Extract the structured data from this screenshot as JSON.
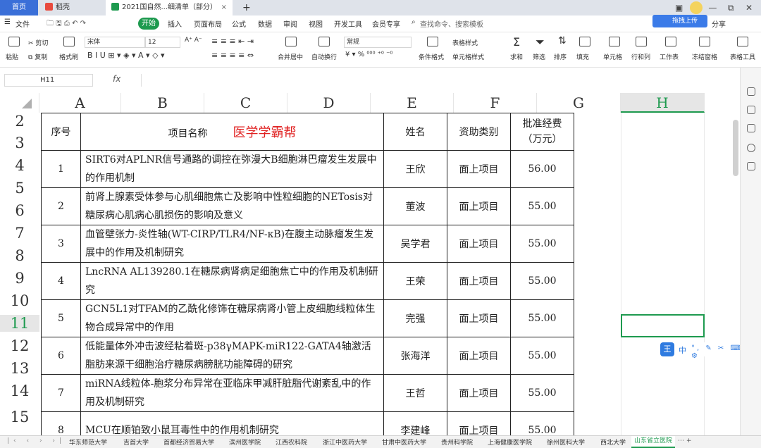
{
  "titlebar": {
    "tabs": [
      {
        "label": "首页"
      },
      {
        "label": "稻壳"
      },
      {
        "label": "2021国自然...细清单（部分）"
      }
    ],
    "add_tab": "+",
    "win_controls": {
      "min": "—",
      "restore": "⧉",
      "close": "✕"
    }
  },
  "menu": {
    "file": "文件",
    "start": "开始",
    "items": [
      "插入",
      "页面布局",
      "公式",
      "数据",
      "审阅",
      "视图",
      "开发工具",
      "会员专享"
    ],
    "search_placeholder": "查找命令、搜索模板",
    "share": "分享"
  },
  "ribbon": {
    "paste": "粘贴",
    "cut": "剪切",
    "copy": "复制",
    "format_painter": "格式刷",
    "font_name": "宋体",
    "font_size": "12",
    "merge": "合并居中",
    "wrap": "自动换行",
    "number_format": "常规",
    "conditional": "条件格式",
    "table_style": "表格样式",
    "cell_style": "单元格样式",
    "sum": "求和",
    "filter": "筛选",
    "sort": "排序",
    "fill": "填充",
    "cell": "单元格",
    "rowcol": "行和列",
    "worksheet": "工作表",
    "freeze": "冻结窗格",
    "table_tools": "表格工具",
    "upload": "拖拽上传"
  },
  "formula_bar": {
    "name_box": "H11",
    "fx": "fx",
    "value": ""
  },
  "columns": [
    "A",
    "B",
    "C",
    "D",
    "E",
    "F",
    "G",
    "H"
  ],
  "rows": [
    "2",
    "3",
    "4",
    "5",
    "6",
    "7",
    "8",
    "9",
    "10",
    "11",
    "12",
    "13",
    "14",
    "15"
  ],
  "table": {
    "headers": {
      "no": "序号",
      "name": "项目名称",
      "watermark": "医学学霸帮",
      "person": "姓名",
      "type": "资助类别",
      "fund": "批准经费（万元）"
    },
    "rows": [
      {
        "no": "1",
        "name": "SIRT6对APLNR信号通路的调控在弥漫大B细胞淋巴瘤发生发展中的作用机制",
        "person": "王欣",
        "type": "面上项目",
        "fund": "56.00"
      },
      {
        "no": "2",
        "name": "前肾上腺素受体参与心肌细胞焦亡及影响中性粒细胞的NETosis对糖尿病心肌病心肌损伤的影响及意义",
        "person": "董波",
        "type": "面上项目",
        "fund": "55.00"
      },
      {
        "no": "3",
        "name": "血管壁张力-炎性轴(WT-CIRP/TLR4/NF-κB)在腹主动脉瘤发生发展中的作用及机制研究",
        "person": "吴学君",
        "type": "面上项目",
        "fund": "55.00"
      },
      {
        "no": "4",
        "name": "LncRNA AL139280.1在糖尿病肾病足细胞焦亡中的作用及机制研究",
        "person": "王荣",
        "type": "面上项目",
        "fund": "55.00"
      },
      {
        "no": "5",
        "name": "GCN5L1对TFAM的乙酰化修饰在糖尿病肾小管上皮细胞线粒体生物合成异常中的作用",
        "person": "完强",
        "type": "面上项目",
        "fund": "55.00"
      },
      {
        "no": "6",
        "name": "低能量体外冲击波经粘着斑-p38γMAPK-miR122-GATA4轴激活脂肪来源干细胞治疗糖尿病膀胱功能障碍的研究",
        "person": "张海洋",
        "type": "面上项目",
        "fund": "55.00"
      },
      {
        "no": "7",
        "name": "miRNA线粒体-胞浆分布异常在亚临床甲减肝脏脂代谢紊乱中的作用及机制研究",
        "person": "王哲",
        "type": "面上项目",
        "fund": "55.00"
      },
      {
        "no": "8",
        "name": "MCU在顺铂致小鼠耳毒性中的作用机制研究",
        "person": "李建峰",
        "type": "面上项目",
        "fund": "55.00"
      }
    ]
  },
  "sheet_tabs": [
    "华东师范大学",
    "吉首大学",
    "首都经济贸易大学",
    "滨州医学院",
    "江西农科院",
    "浙江中医药大学",
    "甘肃中医药大学",
    "贵州科学院",
    "上海健康医学院",
    "徐州医科大学",
    "西北大学",
    "山东省立医院"
  ],
  "active_sheet": "山东省立医院",
  "ime": {
    "label": "中"
  },
  "colors": {
    "accent": "#1e9a4f",
    "title_blue": "#3a6fd8",
    "watermark_red": "#e02020"
  }
}
